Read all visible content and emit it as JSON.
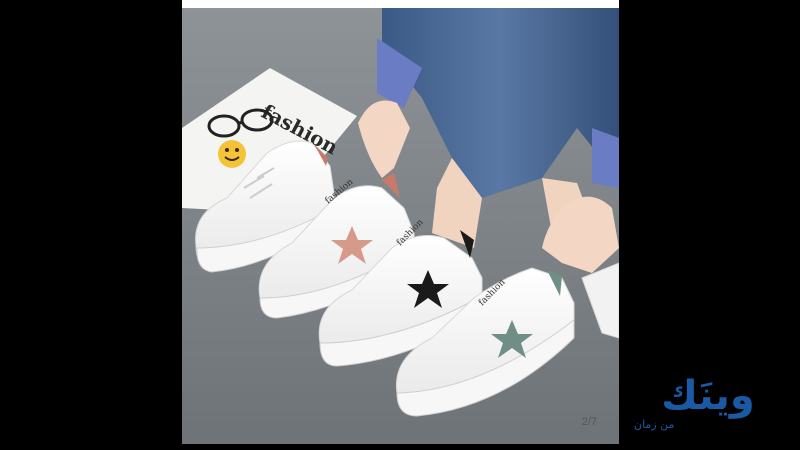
{
  "photo": {
    "card_text": "fashion",
    "shoe_tongue_text": "fashion",
    "star_colors": [
      "#d79a8a",
      "#1a1a1a",
      "#6f8f86"
    ],
    "counter": "2/7"
  },
  "brand": {
    "name": "وينَك",
    "tagline": "من زمان",
    "color": "#1a5aa5"
  }
}
